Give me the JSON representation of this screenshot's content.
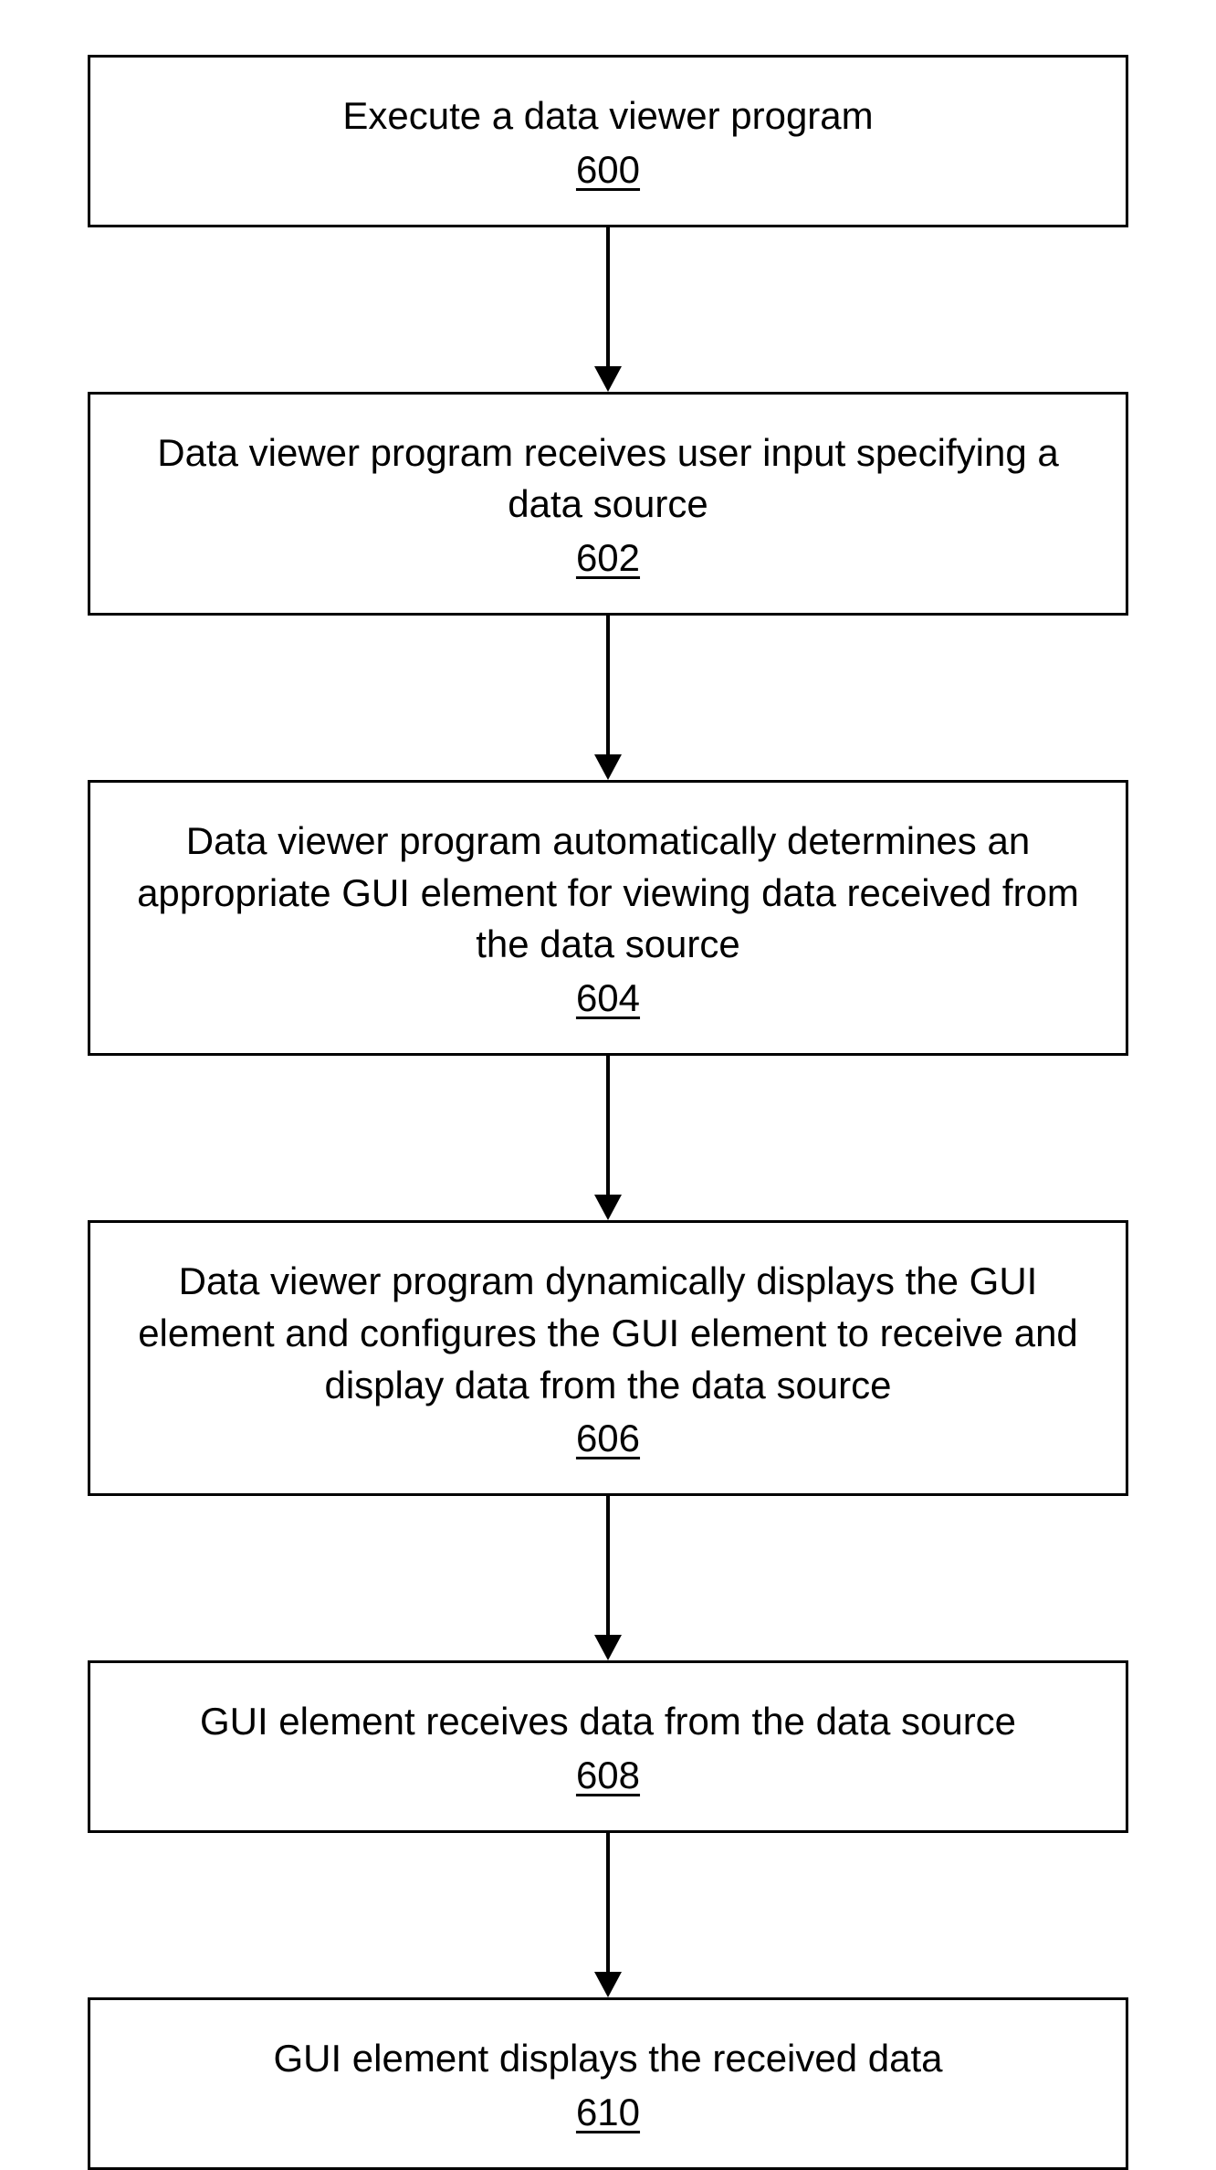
{
  "flowchart": {
    "steps": [
      {
        "text": "Execute a data viewer program",
        "number": "600"
      },
      {
        "text": "Data viewer program receives user input specifying a data source",
        "number": "602"
      },
      {
        "text": "Data viewer program automatically determines an appropriate GUI element for viewing data received from the data source",
        "number": "604"
      },
      {
        "text": "Data viewer program dynamically displays the GUI element and configures the GUI element to receive and display data from the data source",
        "number": "606"
      },
      {
        "text": "GUI element receives data from the data source",
        "number": "608"
      },
      {
        "text": "GUI element displays the received data",
        "number": "610"
      }
    ]
  }
}
